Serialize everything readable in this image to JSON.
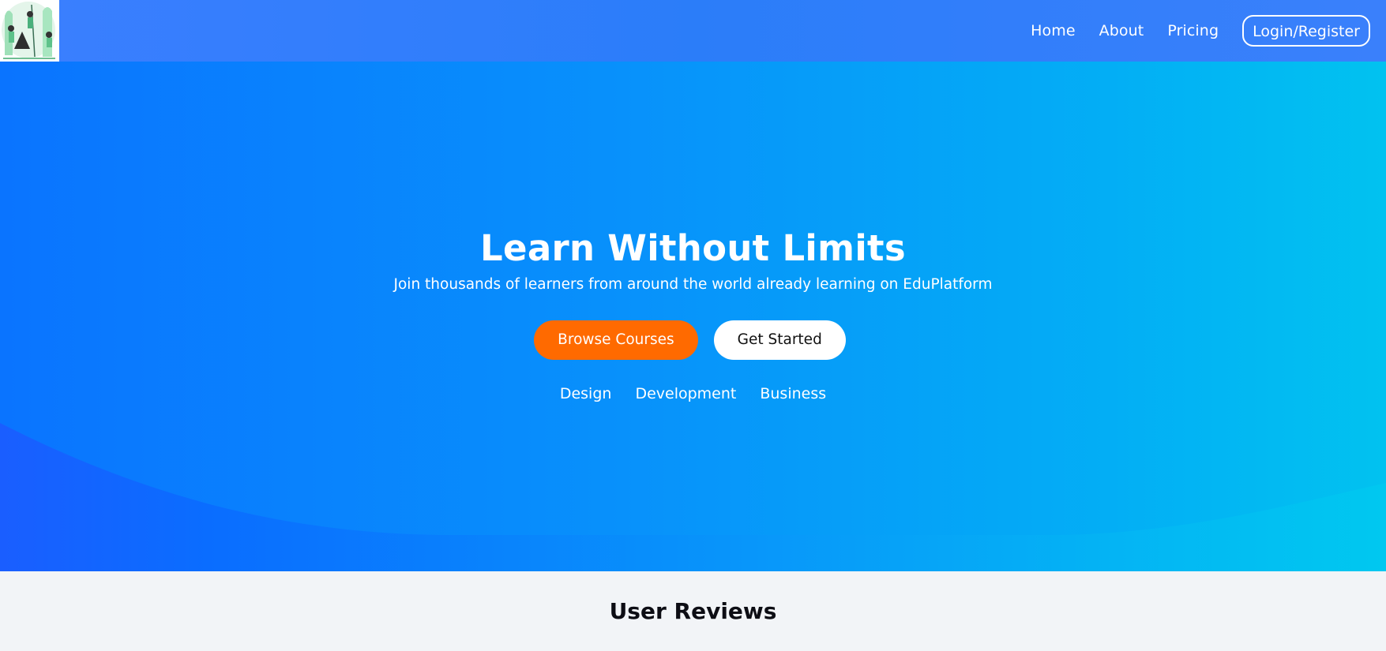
{
  "brand": {
    "logo_icon": "campfire-illustration-icon"
  },
  "nav": {
    "items": [
      {
        "label": "Home"
      },
      {
        "label": "About"
      },
      {
        "label": "Pricing"
      }
    ],
    "login_label": "Login/Register"
  },
  "hero": {
    "title": "Learn Without Limits",
    "subtitle": "Join thousands of learners from around the world already learning on EduPlatform",
    "primary_button": "Browse Courses",
    "secondary_button": "Get Started",
    "categories": [
      "Design",
      "Development",
      "Business"
    ]
  },
  "reviews": {
    "title": "User Reviews"
  },
  "colors": {
    "nav_background": "#2b7df9",
    "hero_gradient_start": "#0a74ff",
    "hero_gradient_end": "#01c2f0",
    "primary_button": "#ff6a00",
    "reviews_background": "#f2f4f7"
  }
}
